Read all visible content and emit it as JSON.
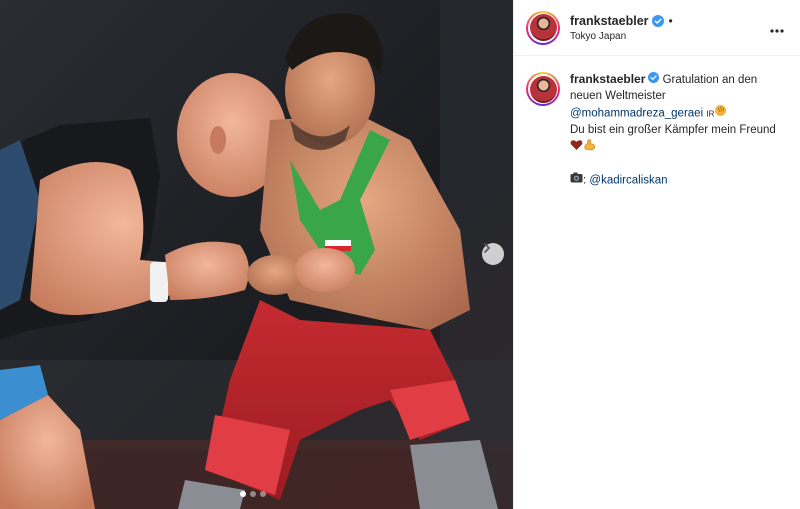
{
  "post": {
    "username": "frankstaebler",
    "separator": "•",
    "location": "Tokyo Japan",
    "carousel": {
      "count": 3,
      "active": 0
    }
  },
  "caption": {
    "username": "frankstaebler",
    "line1": "Gratulation an den neuen Weltmeister",
    "mention": "@mohammadreza_geraei",
    "flag": "IR",
    "line2": "Du bist ein großer Kämpfer mein Freund",
    "credit_prefix": ":",
    "credit_mention": "@kadircaliskan"
  },
  "icons": {
    "verified": "verified-badge-icon",
    "more": "more-options-icon",
    "next": "chevron-right-icon",
    "clap": "clapping-hands-icon",
    "heart": "heart-icon",
    "muscle": "flexed-biceps-icon",
    "camera": "camera-icon"
  },
  "colors": {
    "verified": "#3897f0",
    "link": "#00376b",
    "wrestler_red": "#c7262c",
    "wrestler_green": "#3aa64a"
  }
}
